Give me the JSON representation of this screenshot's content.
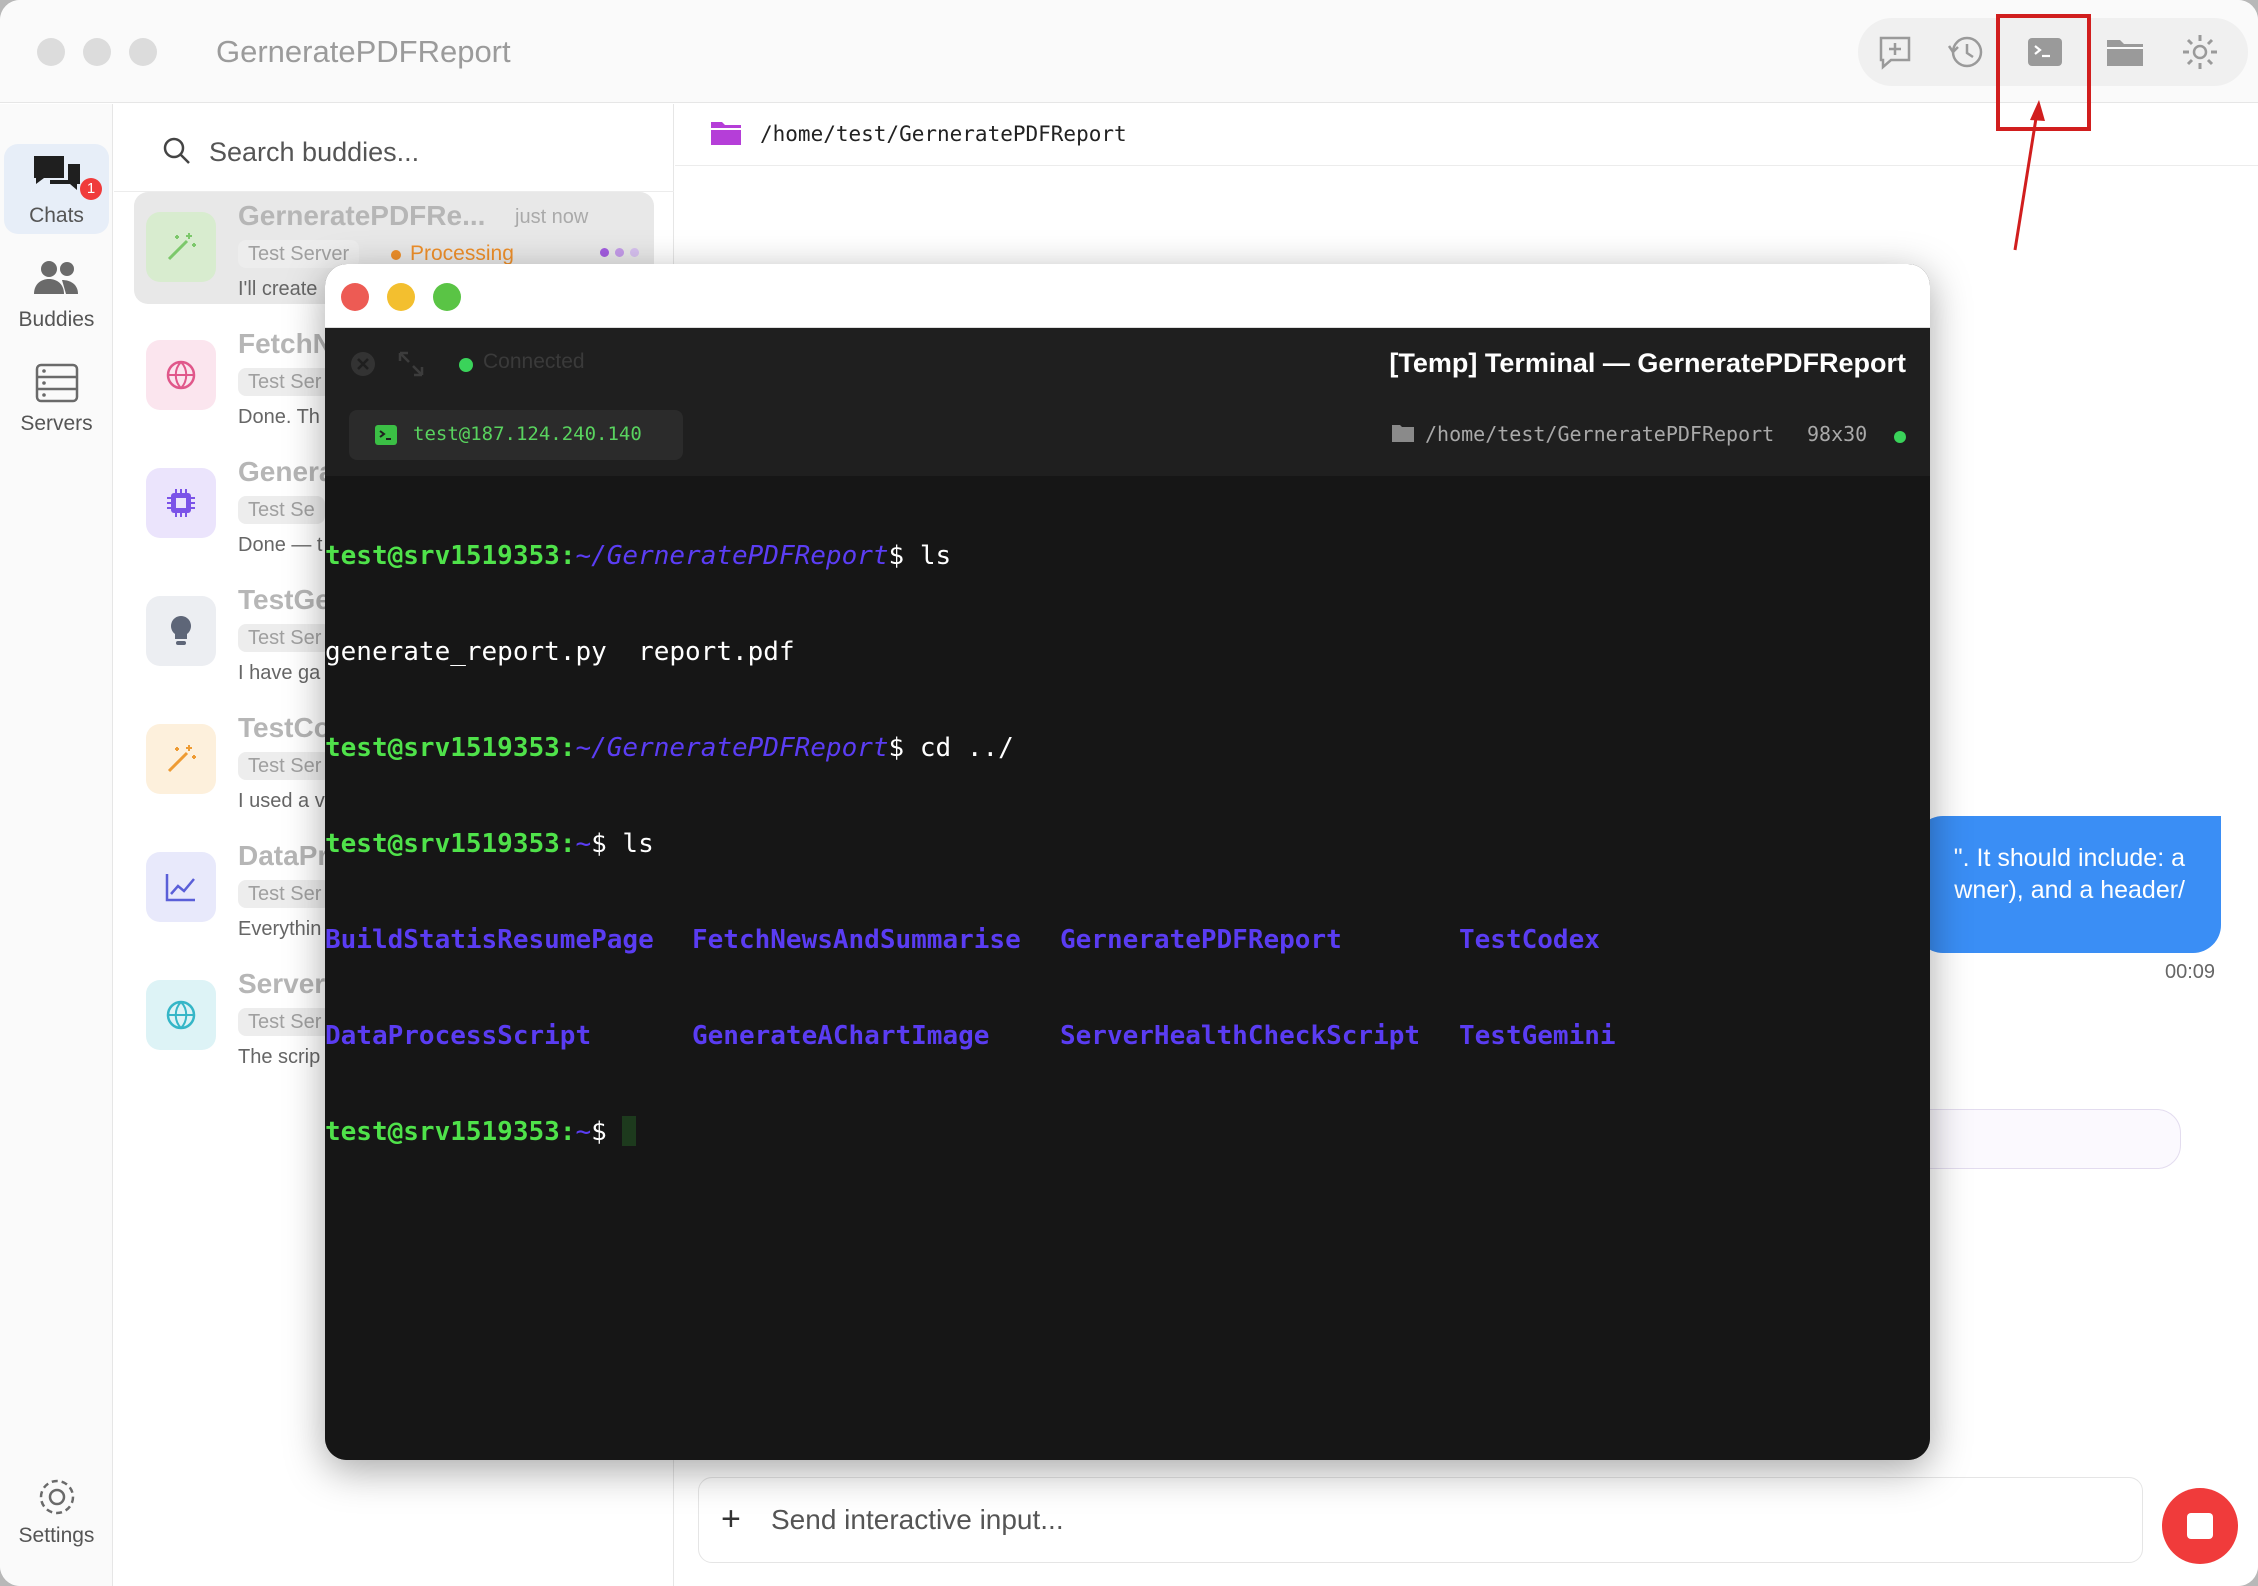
{
  "window": {
    "title": "GerneratePDFReport"
  },
  "rail": {
    "items": [
      {
        "label": "Chats",
        "badge": "1"
      },
      {
        "label": "Buddies"
      },
      {
        "label": "Servers"
      }
    ],
    "settings_label": "Settings"
  },
  "search": {
    "placeholder": "Search buddies..."
  },
  "chats": [
    {
      "name": "GerneratePDFRe...",
      "time": "just now",
      "tag": "Test Server",
      "status": "Processing",
      "preview": "I'll create",
      "icon": "wand-icon",
      "color": "#7cc86b"
    },
    {
      "name": "FetchN",
      "tag": "Test Ser",
      "preview": "Done. Th",
      "icon": "globe-icon",
      "color": "#e0578a"
    },
    {
      "name": "Genera",
      "tag": "Test Se",
      "preview": "Done — t",
      "icon": "chip-icon",
      "color": "#7b53e8"
    },
    {
      "name": "TestGe",
      "tag": "Test Ser",
      "preview": "I have ga",
      "icon": "lightbulb-icon",
      "color": "#5e6678"
    },
    {
      "name": "TestCo",
      "tag": "Test Ser",
      "preview": "I used a v",
      "icon": "wand-icon",
      "color": "#ee9b33"
    },
    {
      "name": "DataPr",
      "tag": "Test Ser",
      "preview": "Everythin",
      "icon": "chart-icon",
      "color": "#5a5fd8"
    },
    {
      "name": "Server",
      "tag": "Test Ser",
      "preview": "The scrip",
      "icon": "globe-icon",
      "color": "#35b6c7"
    }
  ],
  "main": {
    "path": "/home/test/GerneratePDFReport",
    "bubble_lines": [
      "\". It should include: a",
      "wner), and a header/"
    ],
    "bubble_time": "00:09",
    "input_placeholder": "Send interactive input..."
  },
  "terminal": {
    "title": "[Temp] Terminal — GerneratePDFReport",
    "connection": "Connected",
    "host": "test@187.124.240.140",
    "path": "/home/test/GerneratePDFReport",
    "size": "98x30",
    "user": "test@srv1519353",
    "lines": [
      {
        "prompt": "test@srv1519353",
        "cwd": "~/GerneratePDFReport",
        "cmd": "$ ls"
      },
      {
        "out": "generate_report.py  report.pdf"
      },
      {
        "prompt": "test@srv1519353",
        "cwd": "~/GerneratePDFReport",
        "cmd": "$ cd ../"
      },
      {
        "prompt": "test@srv1519353",
        "cwd": "~",
        "cmd": "$ ls"
      }
    ],
    "dirs_row1": [
      "BuildStatisResumePage",
      "FetchNewsAndSummarise",
      "GerneratePDFReport",
      "TestCodex"
    ],
    "dirs_row2": [
      "DataProcessScript",
      "GenerateAChartImage",
      "ServerHealthCheckScript",
      "TestGemini"
    ],
    "last_prompt": {
      "prompt": "test@srv1519353",
      "cwd": "~",
      "cmd": "$ "
    }
  },
  "colors": {
    "accent": "#3a8ef5",
    "stop": "#f03b3b",
    "highlight": "#d11e1e",
    "processing": "#ee8f2a"
  }
}
